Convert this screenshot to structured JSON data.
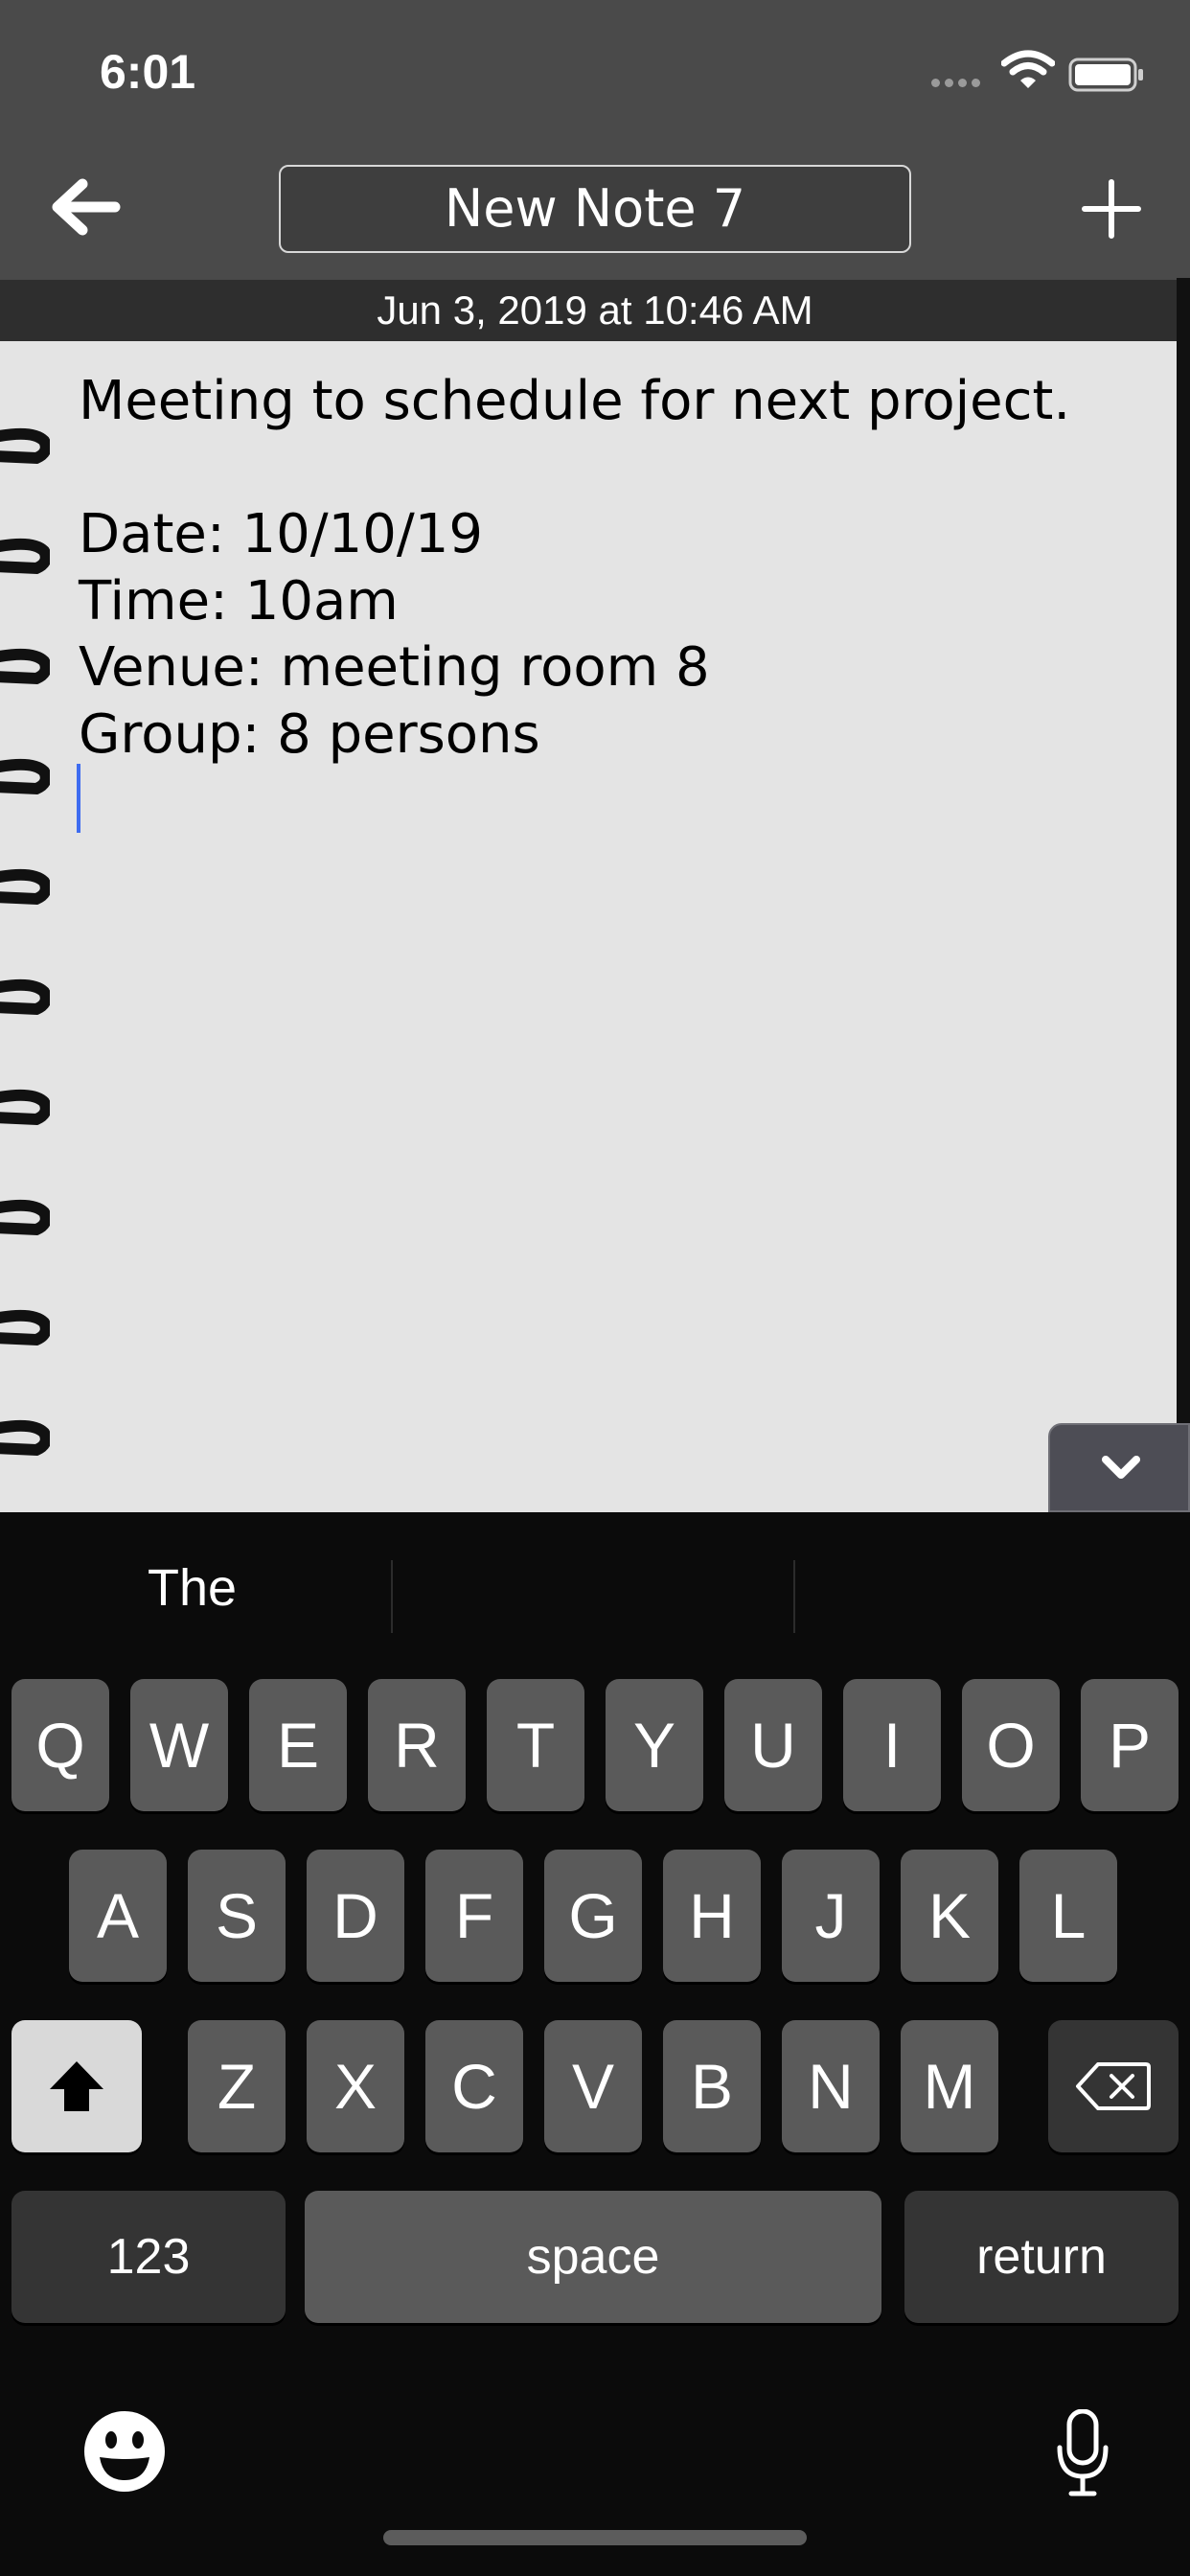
{
  "status_bar": {
    "time": "6:01"
  },
  "nav": {
    "title": "New Note 7",
    "back_icon": "arrow-left-icon",
    "add_icon": "plus-icon"
  },
  "note": {
    "date": "Jun 3, 2019 at 10:46 AM",
    "body": "Meeting to schedule for next project.\n\nDate: 10/10/19\nTime: 10am\nVenue: meeting room 8\nGroup: 8 persons"
  },
  "keyboard": {
    "suggestions": [
      "The",
      "",
      ""
    ],
    "row1": [
      "Q",
      "W",
      "E",
      "R",
      "T",
      "Y",
      "U",
      "I",
      "O",
      "P"
    ],
    "row2": [
      "A",
      "S",
      "D",
      "F",
      "G",
      "H",
      "J",
      "K",
      "L"
    ],
    "row3": [
      "Z",
      "X",
      "C",
      "V",
      "B",
      "N",
      "M"
    ],
    "numbers_label": "123",
    "space_label": "space",
    "return_label": "return"
  },
  "colors": {
    "bar": "#4a4a4a",
    "paper": "#e4e4e4",
    "caret": "#3e6cf0",
    "key": "#5a5a5a",
    "function_key": "#343434"
  }
}
